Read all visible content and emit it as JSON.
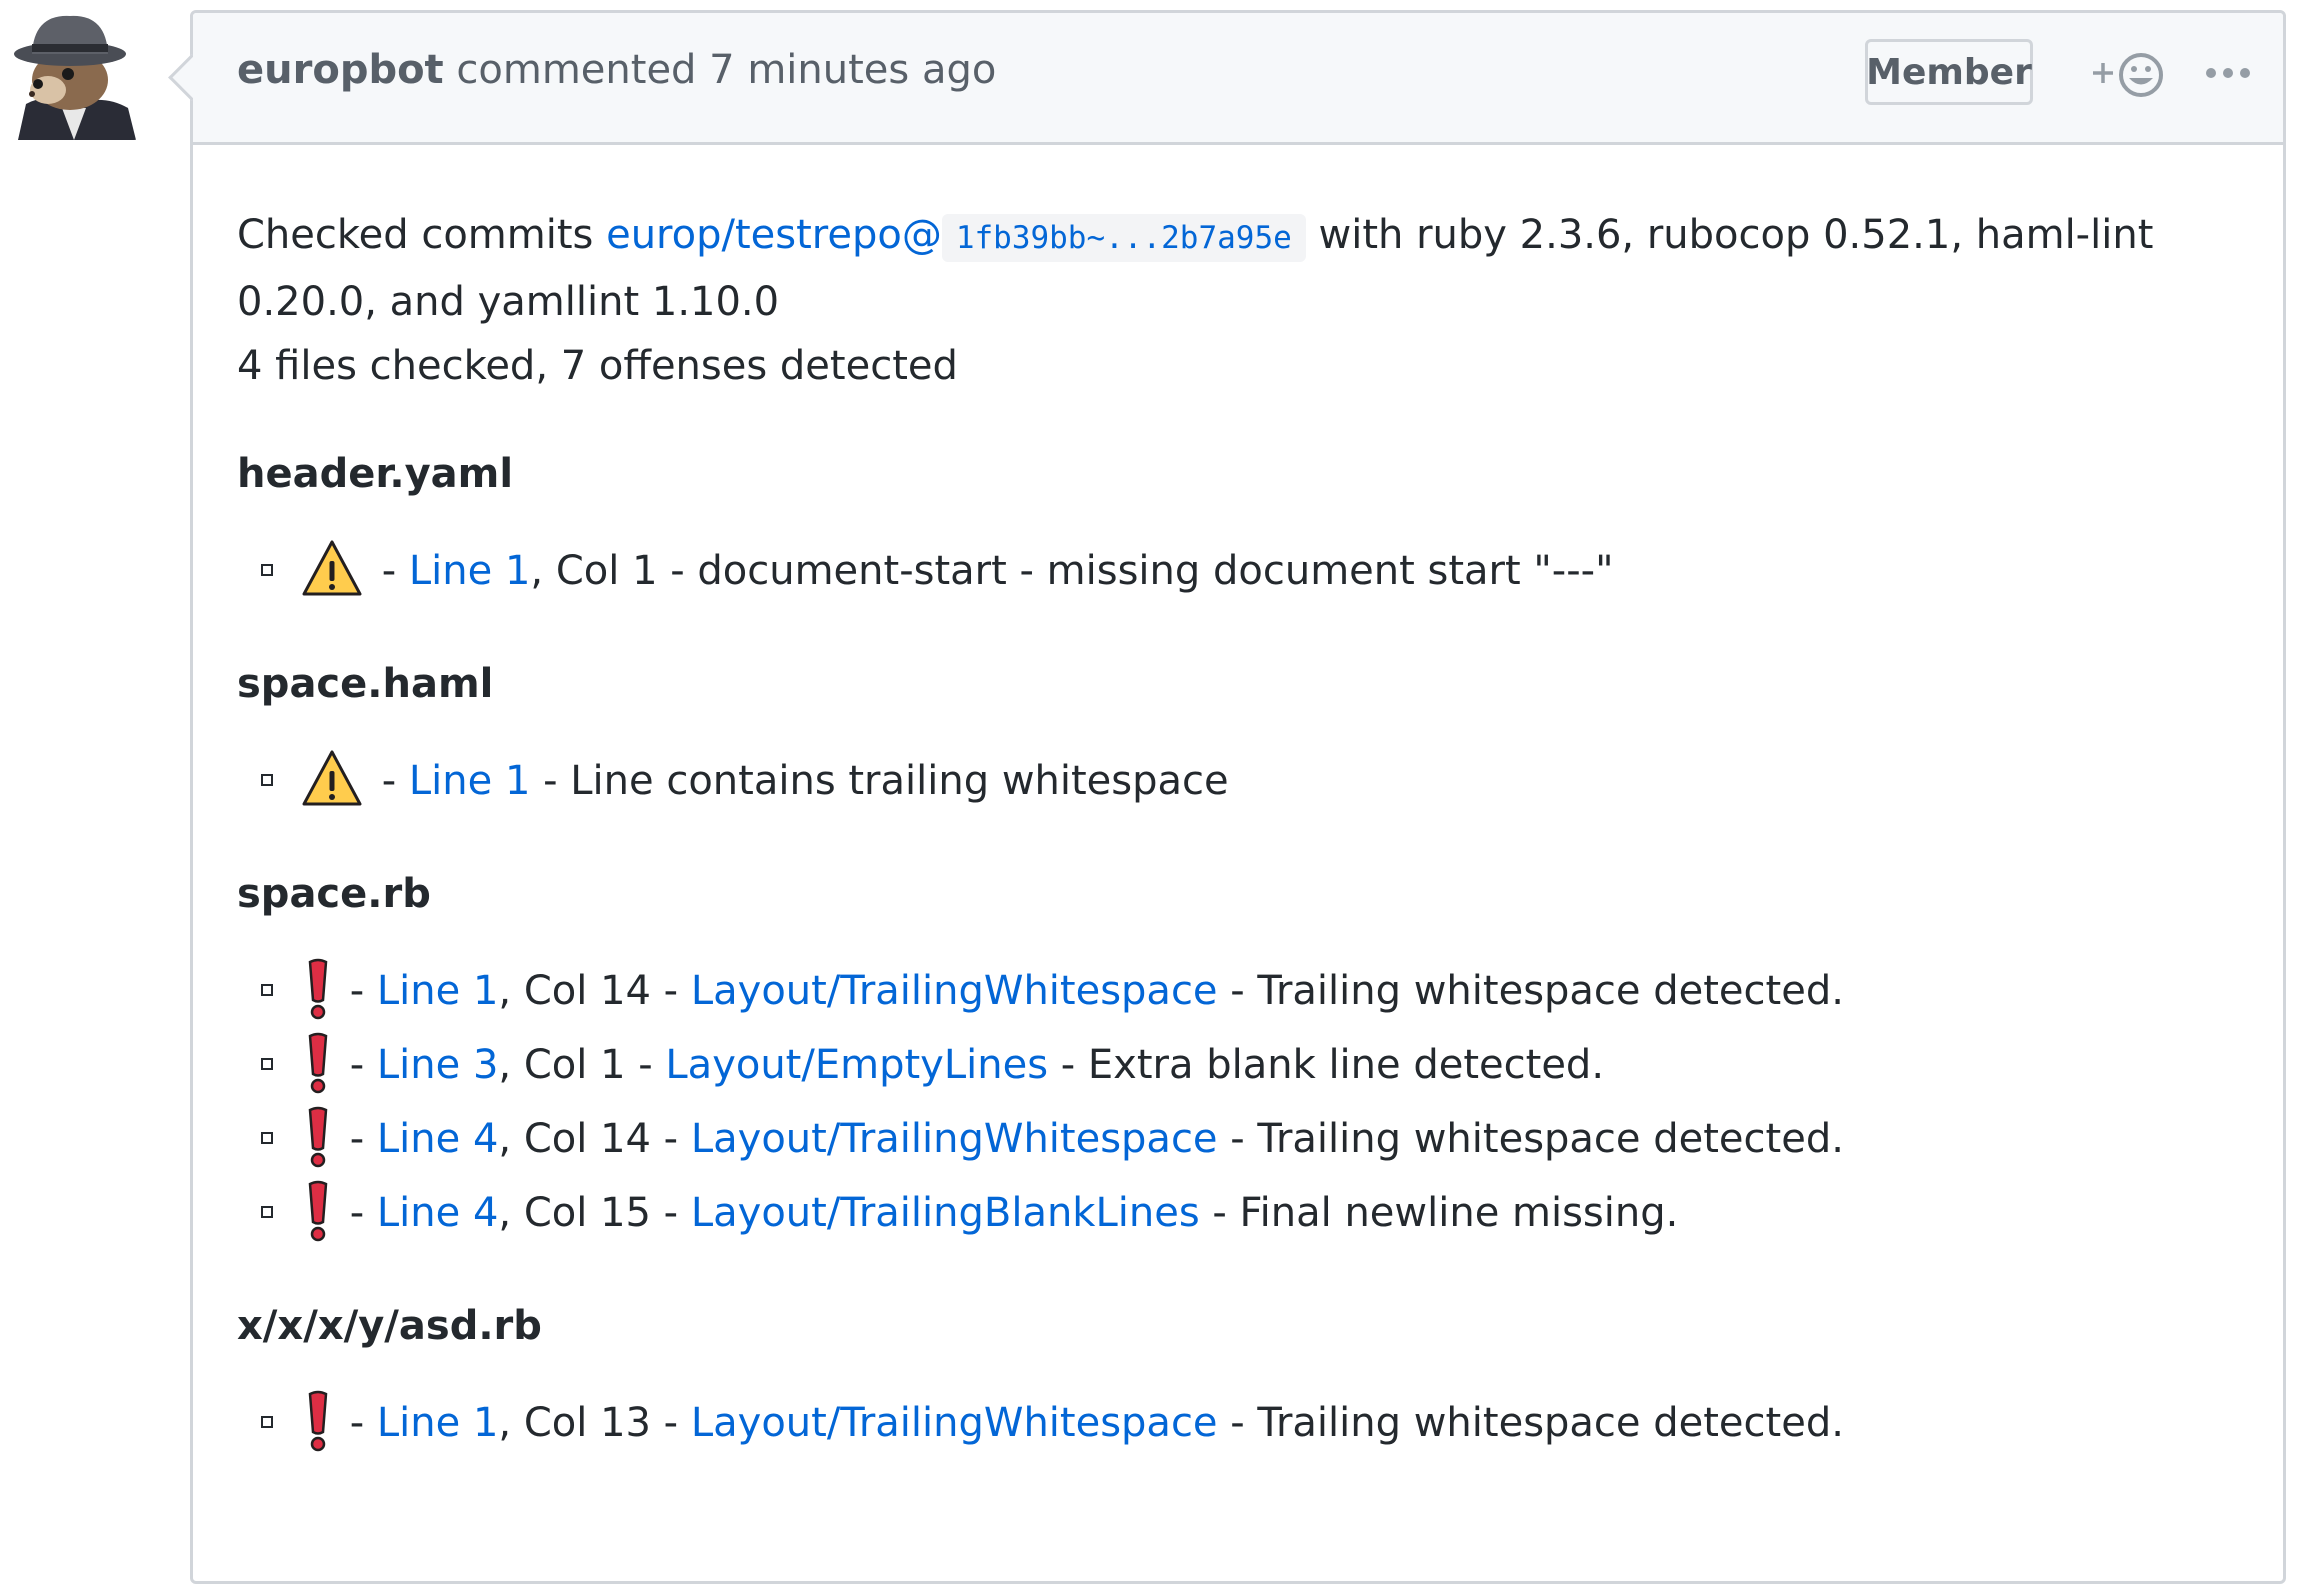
{
  "comment": {
    "author": "europbot",
    "action": "commented",
    "time": "7 minutes ago",
    "role_badge": "Member",
    "reaction_icon": "smiley-plus-icon",
    "menu_icon": "ellipsis-icon"
  },
  "body": {
    "intro_text": "Checked commits ",
    "repo_link": "europ/testrepo@",
    "commit_range": "1fb39bb~...2b7a95e",
    "tools_text": " with ruby 2.3.6, rubocop 0.52.1, haml-lint 0.20.0, and yamllint 1.10.0",
    "summary": "4 files checked, 7 offenses detected"
  },
  "files": [
    {
      "name": "header.yaml",
      "offenses": [
        {
          "severity": "warning",
          "line": "Line 1",
          "col": ", Col 1",
          "cop": "",
          "message": " - document-start - missing document start \"---\""
        }
      ]
    },
    {
      "name": "space.haml",
      "offenses": [
        {
          "severity": "warning",
          "line": "Line 1",
          "col": "",
          "cop": "",
          "message": " - Line contains trailing whitespace"
        }
      ]
    },
    {
      "name": "space.rb",
      "offenses": [
        {
          "severity": "error",
          "line": "Line 1",
          "col": ", Col 14",
          "cop": "Layout/TrailingWhitespace",
          "message": " - Trailing whitespace detected."
        },
        {
          "severity": "error",
          "line": "Line 3",
          "col": ", Col 1",
          "cop": "Layout/EmptyLines",
          "message": " - Extra blank line detected."
        },
        {
          "severity": "error",
          "line": "Line 4",
          "col": ", Col 14",
          "cop": "Layout/TrailingWhitespace",
          "message": " - Trailing whitespace detected."
        },
        {
          "severity": "error",
          "line": "Line 4",
          "col": ", Col 15",
          "cop": "Layout/TrailingBlankLines",
          "message": " - Final newline missing."
        }
      ]
    },
    {
      "name": "x/x/x/y/asd.rb",
      "offenses": [
        {
          "severity": "error",
          "line": "Line 1",
          "col": ", Col 13",
          "cop": "Layout/TrailingWhitespace",
          "message": " - Trailing whitespace detected."
        }
      ]
    }
  ],
  "colors": {
    "link": "#0366d6",
    "warning_fill": "#ffcc4d",
    "error_fill": "#dd2e44",
    "border": "#d1d5da",
    "header_bg": "#f6f8fa"
  }
}
